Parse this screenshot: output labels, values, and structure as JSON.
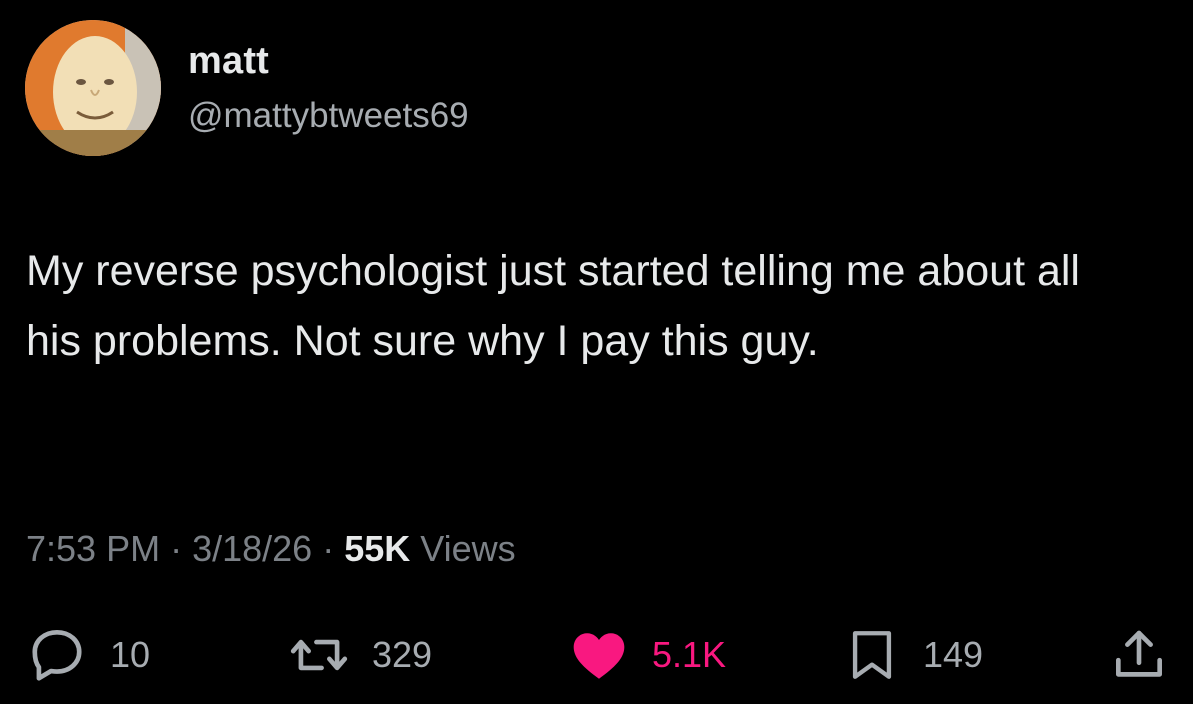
{
  "author": {
    "display_name": "matt",
    "handle": "@mattybtweets69"
  },
  "tweet": {
    "text": "My reverse psychologist just started telling me about all his problems. Not sure why I pay this guy."
  },
  "meta": {
    "time": "7:53 PM",
    "separator": " · ",
    "date": "3/18/26",
    "views_count": "55K",
    "views_label": " Views"
  },
  "actions": {
    "replies": "10",
    "retweets": "329",
    "likes": "5.1K",
    "bookmarks": "149"
  },
  "icons": {
    "reply": "reply-bubble-icon",
    "retweet": "retweet-icon",
    "like": "heart-icon",
    "bookmark": "bookmark-icon",
    "share": "share-icon"
  },
  "colors": {
    "background": "#000000",
    "text": "#e7e9ea",
    "secondary": "#7c8187",
    "like": "#f91880"
  }
}
